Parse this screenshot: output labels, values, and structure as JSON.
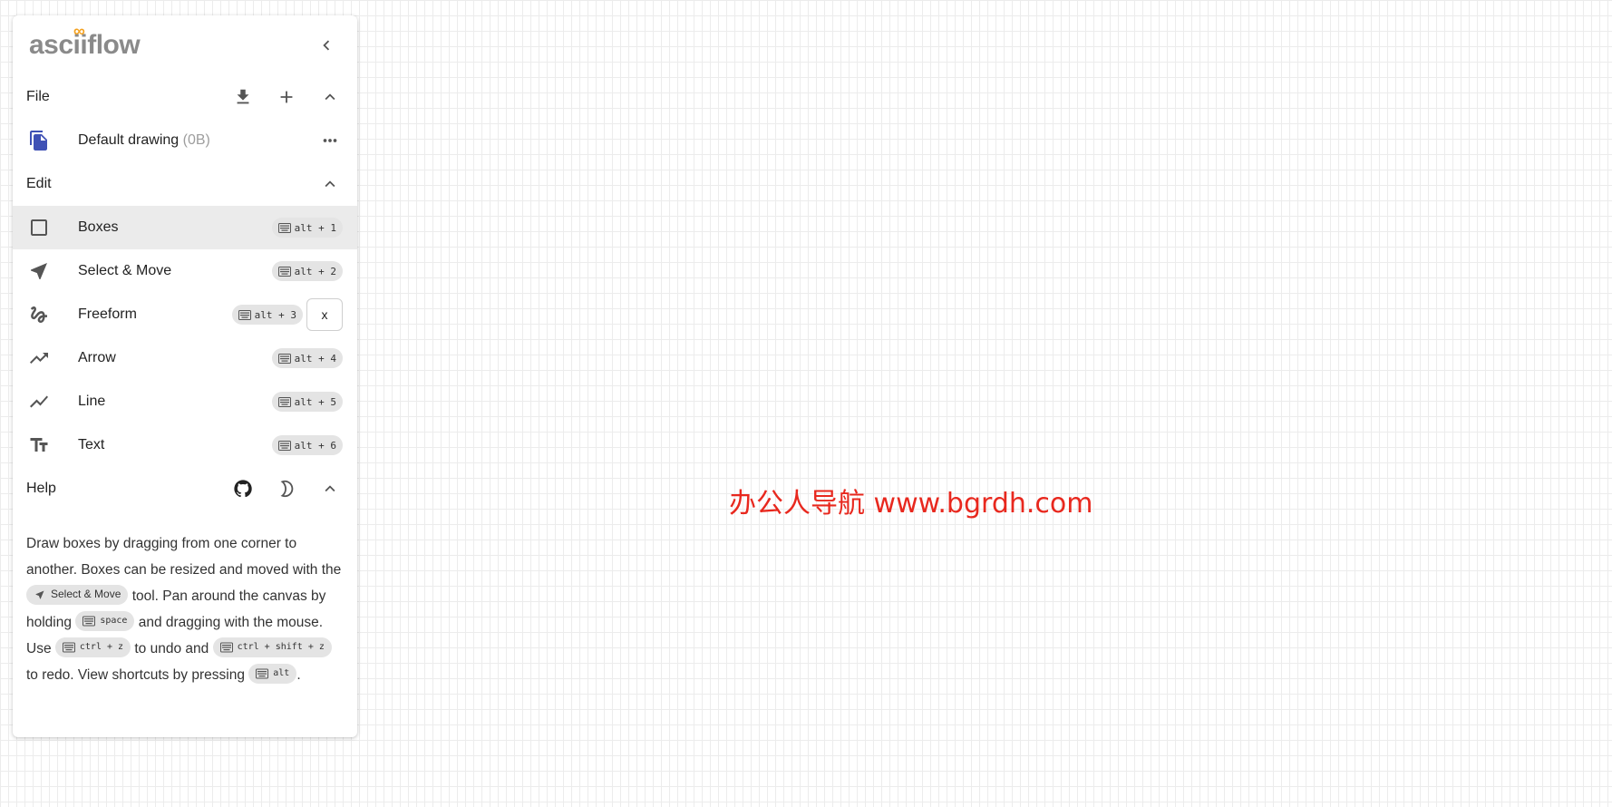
{
  "app": {
    "logo_text": "ascii",
    "logo_text_end": "flow",
    "logo_accent": "∞"
  },
  "colors": {
    "accent": "#3f51b5",
    "logo_orange": "#f4a11f",
    "selected_bg": "#ebebeb",
    "watermark": "#e8281e"
  },
  "file_section": {
    "title": "File",
    "icons": [
      "download-icon",
      "add-icon",
      "chevron-up-icon"
    ],
    "drawing": {
      "name": "Default drawing",
      "size": "(0B)",
      "icon": "file-copy-icon",
      "menu_icon": "more-horiz-icon"
    }
  },
  "edit_section": {
    "title": "Edit",
    "tools": [
      {
        "label": "Boxes",
        "shortcut": "alt + 1",
        "icon": "square-icon",
        "selected": true
      },
      {
        "label": "Select & Move",
        "shortcut": "alt + 2",
        "icon": "navigation-icon",
        "selected": false
      },
      {
        "label": "Freeform",
        "shortcut": "alt + 3",
        "icon": "gesture-icon",
        "selected": false,
        "extra_button": "x"
      },
      {
        "label": "Arrow",
        "shortcut": "alt + 4",
        "icon": "trending-up-icon",
        "selected": false
      },
      {
        "label": "Line",
        "shortcut": "alt + 5",
        "icon": "show-chart-icon",
        "selected": false
      },
      {
        "label": "Text",
        "shortcut": "alt + 6",
        "icon": "text-fields-icon",
        "selected": false
      }
    ]
  },
  "help_section": {
    "title": "Help",
    "icons": [
      "github-icon",
      "dark-mode-icon",
      "chevron-up-icon"
    ],
    "text": {
      "p1": "Draw boxes by dragging from one corner to another. Boxes can be resized and moved with the",
      "chip_select": "Select & Move",
      "p2": "tool. Pan around the canvas by holding",
      "chip_space": "space",
      "p3": "and dragging with the mouse. Use",
      "chip_undo": "ctrl + z",
      "p4": "to undo and",
      "chip_redo": "ctrl + shift + z",
      "p5": "to redo. View shortcuts by pressing",
      "chip_alt": "alt",
      "p6": "."
    }
  },
  "watermark": "办公人导航 www.bgrdh.com"
}
